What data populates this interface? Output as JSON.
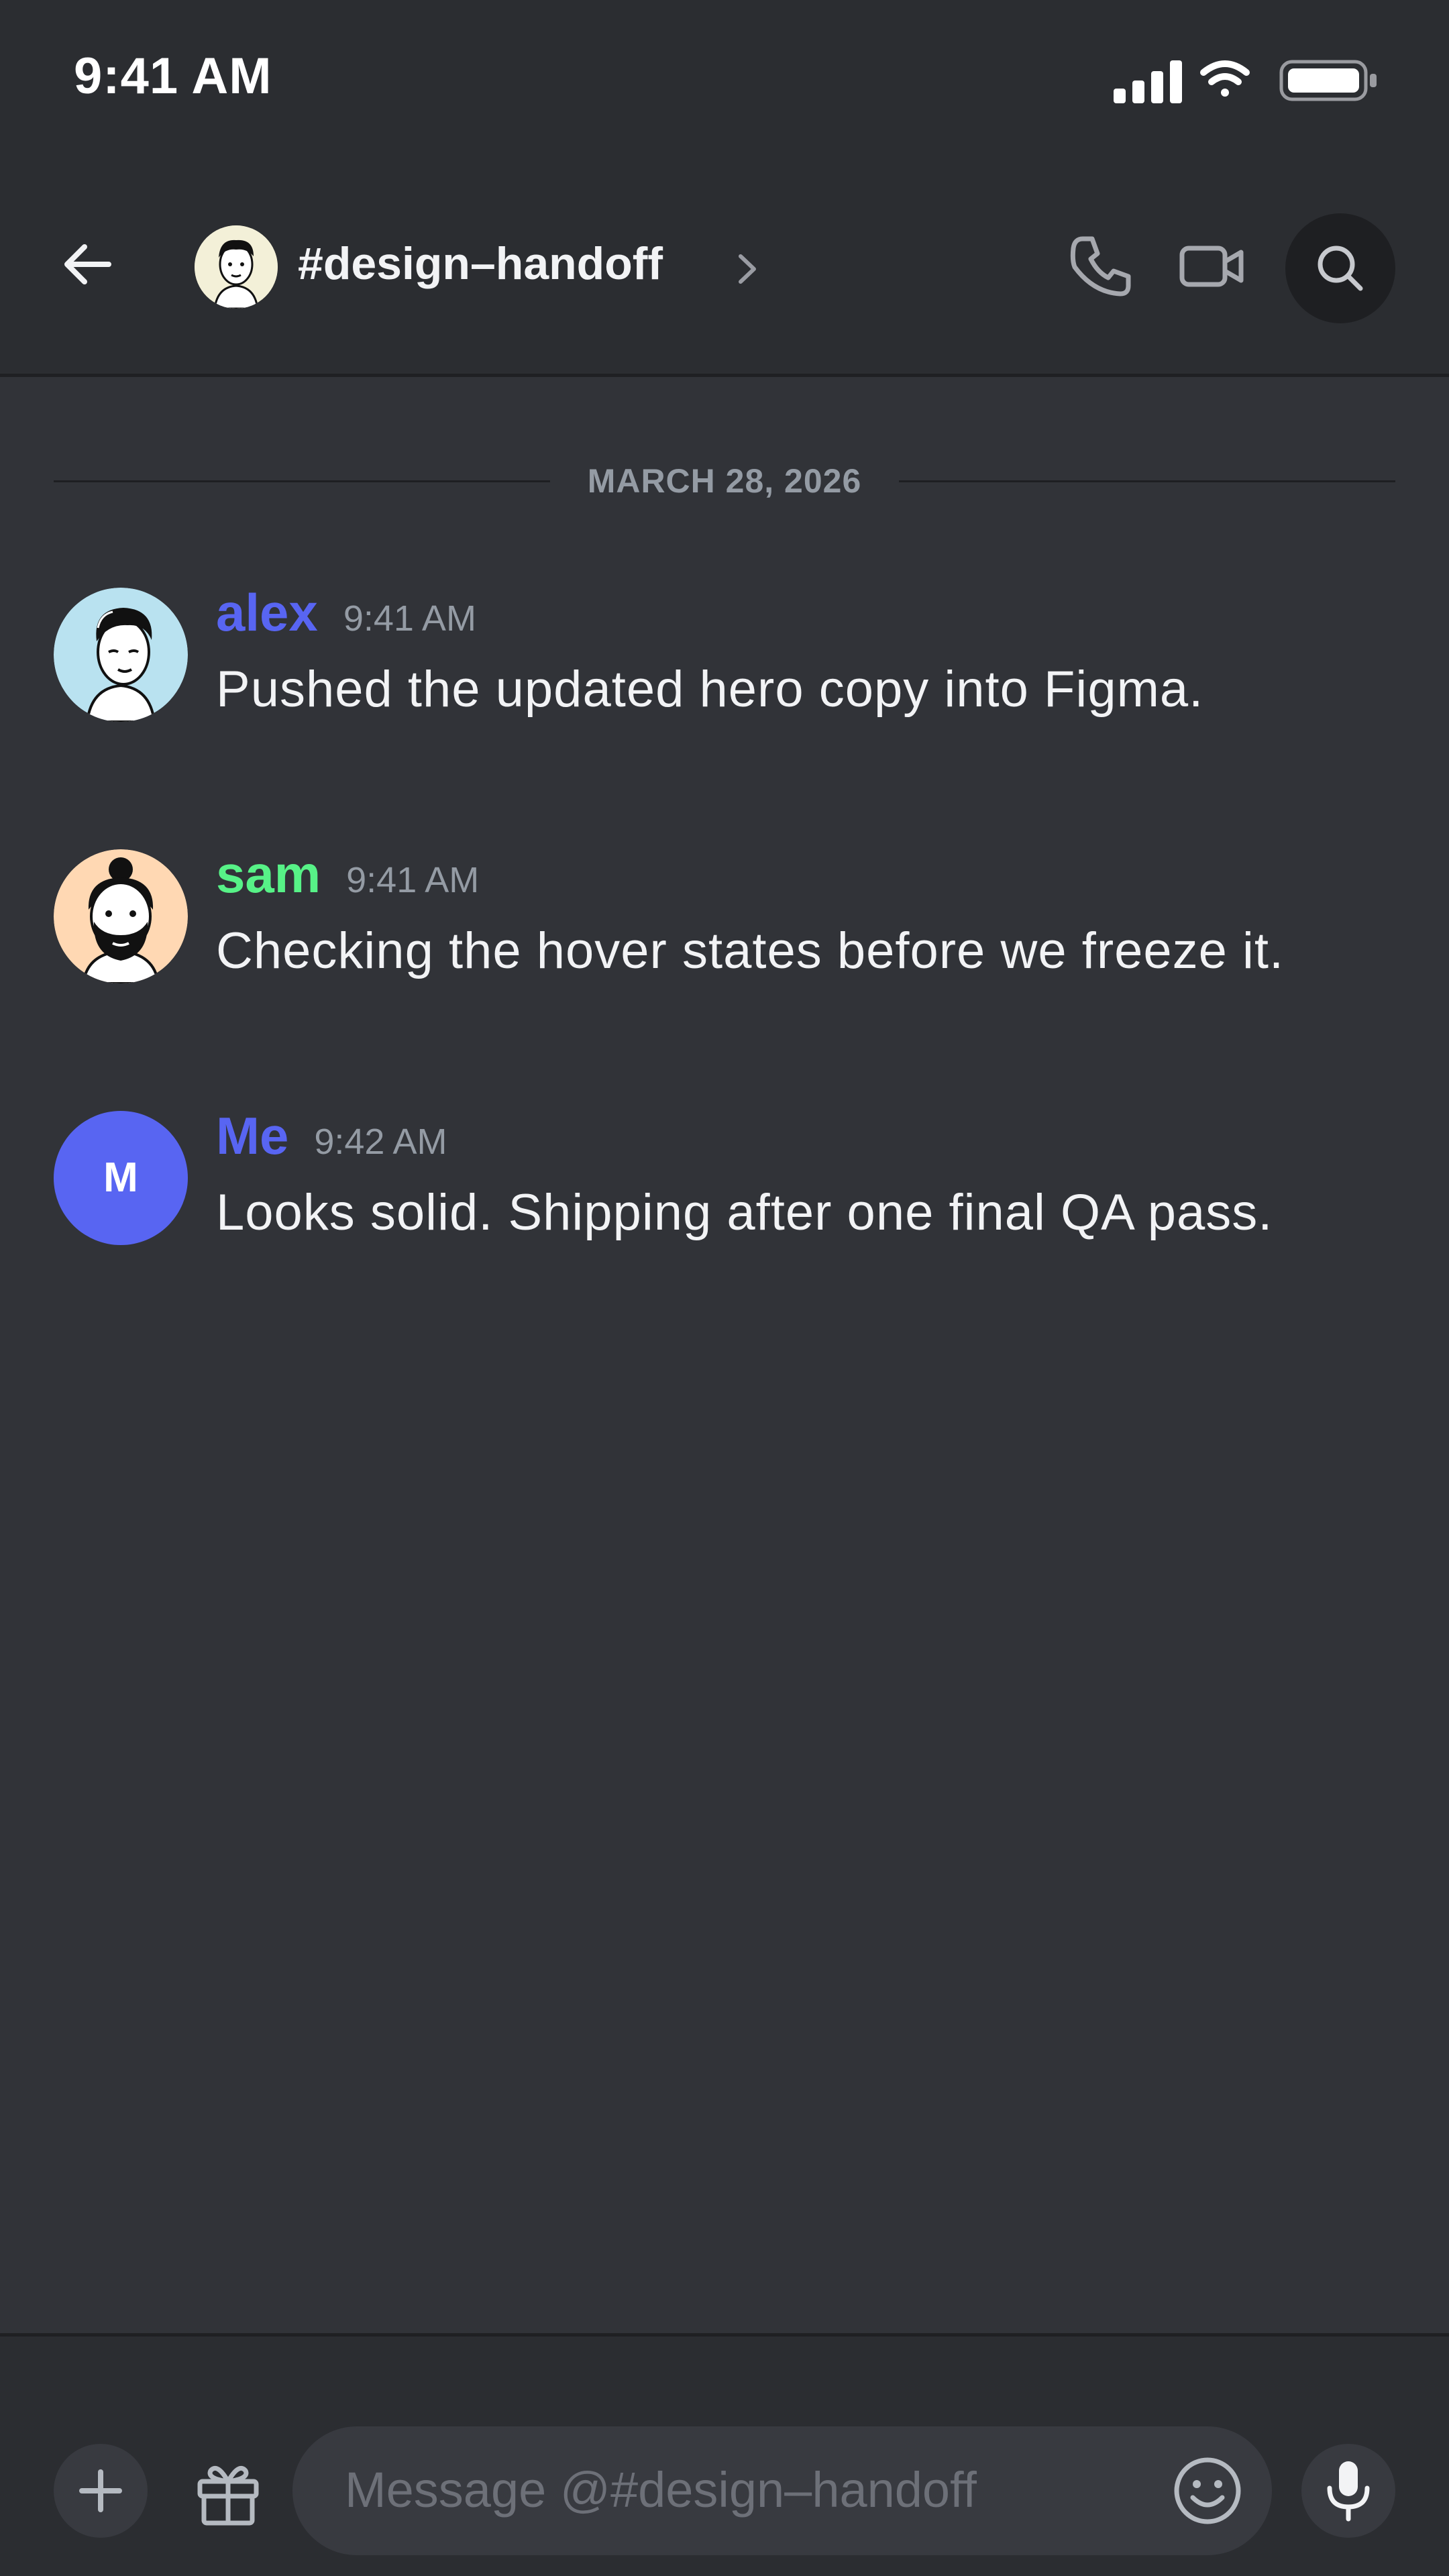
{
  "status_bar": {
    "time": "9:41 AM",
    "icons": [
      "signal-icon",
      "wifi-icon",
      "battery-icon"
    ]
  },
  "header": {
    "channel_name": "#design–handoff",
    "icons": [
      "back-arrow-icon",
      "chevron-right-icon",
      "phone-icon",
      "video-camera-icon",
      "search-icon"
    ]
  },
  "date_divider": "MARCH 28, 2026",
  "messages": [
    {
      "author": "alex",
      "time": "9:41 AM",
      "text": "Pushed the updated hero copy into Figma.",
      "author_color": "#5865f2"
    },
    {
      "author": "sam",
      "time": "9:41 AM",
      "text": "Checking the hover states before we freeze it.",
      "author_color": "#57f287"
    },
    {
      "author": "Me",
      "time": "9:42 AM",
      "text": "Looks solid. Shipping after one final QA pass.",
      "author_color": "#5865f2",
      "avatar_initial": "M"
    }
  ],
  "composer": {
    "placeholder": "Message @#design–handoff",
    "icons": [
      "plus-icon",
      "gift-icon",
      "emoji-icon",
      "microphone-icon"
    ]
  },
  "colors": {
    "background": "#313338",
    "header": "#2b2d31",
    "accent": "#5865f2",
    "green": "#57f287"
  }
}
